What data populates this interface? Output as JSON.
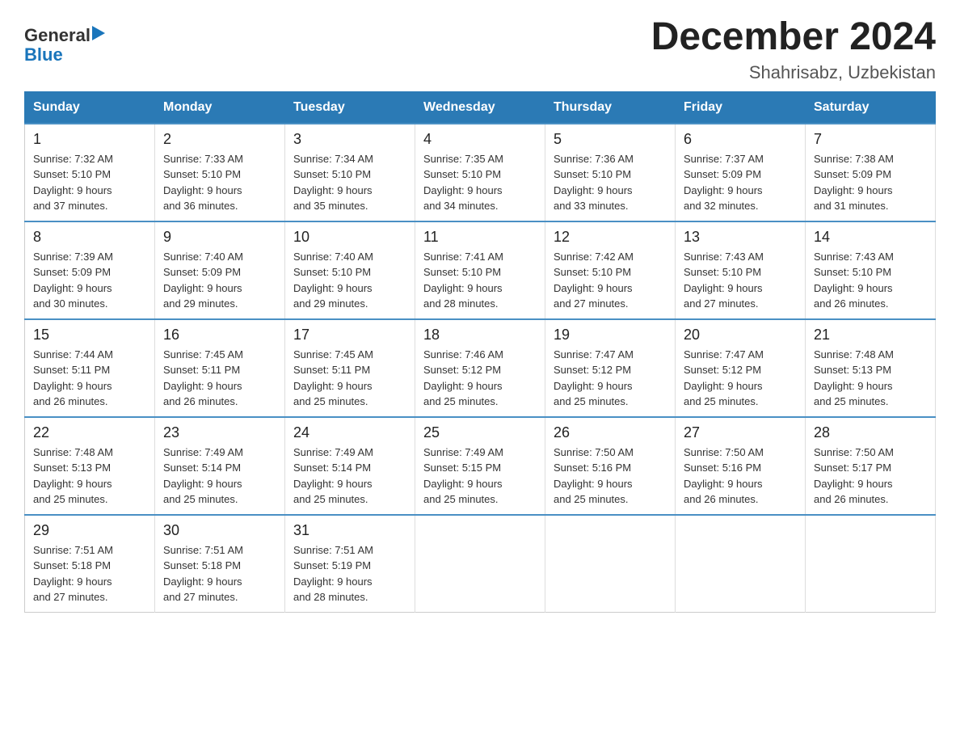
{
  "logo": {
    "general": "General",
    "arrow": "▶",
    "blue": "Blue"
  },
  "header": {
    "title": "December 2024",
    "subtitle": "Shahrisabz, Uzbekistan"
  },
  "weekdays": [
    "Sunday",
    "Monday",
    "Tuesday",
    "Wednesday",
    "Thursday",
    "Friday",
    "Saturday"
  ],
  "weeks": [
    [
      {
        "day": "1",
        "sunrise": "7:32 AM",
        "sunset": "5:10 PM",
        "daylight": "9 hours and 37 minutes."
      },
      {
        "day": "2",
        "sunrise": "7:33 AM",
        "sunset": "5:10 PM",
        "daylight": "9 hours and 36 minutes."
      },
      {
        "day": "3",
        "sunrise": "7:34 AM",
        "sunset": "5:10 PM",
        "daylight": "9 hours and 35 minutes."
      },
      {
        "day": "4",
        "sunrise": "7:35 AM",
        "sunset": "5:10 PM",
        "daylight": "9 hours and 34 minutes."
      },
      {
        "day": "5",
        "sunrise": "7:36 AM",
        "sunset": "5:10 PM",
        "daylight": "9 hours and 33 minutes."
      },
      {
        "day": "6",
        "sunrise": "7:37 AM",
        "sunset": "5:09 PM",
        "daylight": "9 hours and 32 minutes."
      },
      {
        "day": "7",
        "sunrise": "7:38 AM",
        "sunset": "5:09 PM",
        "daylight": "9 hours and 31 minutes."
      }
    ],
    [
      {
        "day": "8",
        "sunrise": "7:39 AM",
        "sunset": "5:09 PM",
        "daylight": "9 hours and 30 minutes."
      },
      {
        "day": "9",
        "sunrise": "7:40 AM",
        "sunset": "5:09 PM",
        "daylight": "9 hours and 29 minutes."
      },
      {
        "day": "10",
        "sunrise": "7:40 AM",
        "sunset": "5:10 PM",
        "daylight": "9 hours and 29 minutes."
      },
      {
        "day": "11",
        "sunrise": "7:41 AM",
        "sunset": "5:10 PM",
        "daylight": "9 hours and 28 minutes."
      },
      {
        "day": "12",
        "sunrise": "7:42 AM",
        "sunset": "5:10 PM",
        "daylight": "9 hours and 27 minutes."
      },
      {
        "day": "13",
        "sunrise": "7:43 AM",
        "sunset": "5:10 PM",
        "daylight": "9 hours and 27 minutes."
      },
      {
        "day": "14",
        "sunrise": "7:43 AM",
        "sunset": "5:10 PM",
        "daylight": "9 hours and 26 minutes."
      }
    ],
    [
      {
        "day": "15",
        "sunrise": "7:44 AM",
        "sunset": "5:11 PM",
        "daylight": "9 hours and 26 minutes."
      },
      {
        "day": "16",
        "sunrise": "7:45 AM",
        "sunset": "5:11 PM",
        "daylight": "9 hours and 26 minutes."
      },
      {
        "day": "17",
        "sunrise": "7:45 AM",
        "sunset": "5:11 PM",
        "daylight": "9 hours and 25 minutes."
      },
      {
        "day": "18",
        "sunrise": "7:46 AM",
        "sunset": "5:12 PM",
        "daylight": "9 hours and 25 minutes."
      },
      {
        "day": "19",
        "sunrise": "7:47 AM",
        "sunset": "5:12 PM",
        "daylight": "9 hours and 25 minutes."
      },
      {
        "day": "20",
        "sunrise": "7:47 AM",
        "sunset": "5:12 PM",
        "daylight": "9 hours and 25 minutes."
      },
      {
        "day": "21",
        "sunrise": "7:48 AM",
        "sunset": "5:13 PM",
        "daylight": "9 hours and 25 minutes."
      }
    ],
    [
      {
        "day": "22",
        "sunrise": "7:48 AM",
        "sunset": "5:13 PM",
        "daylight": "9 hours and 25 minutes."
      },
      {
        "day": "23",
        "sunrise": "7:49 AM",
        "sunset": "5:14 PM",
        "daylight": "9 hours and 25 minutes."
      },
      {
        "day": "24",
        "sunrise": "7:49 AM",
        "sunset": "5:14 PM",
        "daylight": "9 hours and 25 minutes."
      },
      {
        "day": "25",
        "sunrise": "7:49 AM",
        "sunset": "5:15 PM",
        "daylight": "9 hours and 25 minutes."
      },
      {
        "day": "26",
        "sunrise": "7:50 AM",
        "sunset": "5:16 PM",
        "daylight": "9 hours and 25 minutes."
      },
      {
        "day": "27",
        "sunrise": "7:50 AM",
        "sunset": "5:16 PM",
        "daylight": "9 hours and 26 minutes."
      },
      {
        "day": "28",
        "sunrise": "7:50 AM",
        "sunset": "5:17 PM",
        "daylight": "9 hours and 26 minutes."
      }
    ],
    [
      {
        "day": "29",
        "sunrise": "7:51 AM",
        "sunset": "5:18 PM",
        "daylight": "9 hours and 27 minutes."
      },
      {
        "day": "30",
        "sunrise": "7:51 AM",
        "sunset": "5:18 PM",
        "daylight": "9 hours and 27 minutes."
      },
      {
        "day": "31",
        "sunrise": "7:51 AM",
        "sunset": "5:19 PM",
        "daylight": "9 hours and 28 minutes."
      },
      null,
      null,
      null,
      null
    ]
  ],
  "labels": {
    "sunrise": "Sunrise:",
    "sunset": "Sunset:",
    "daylight": "Daylight:"
  }
}
